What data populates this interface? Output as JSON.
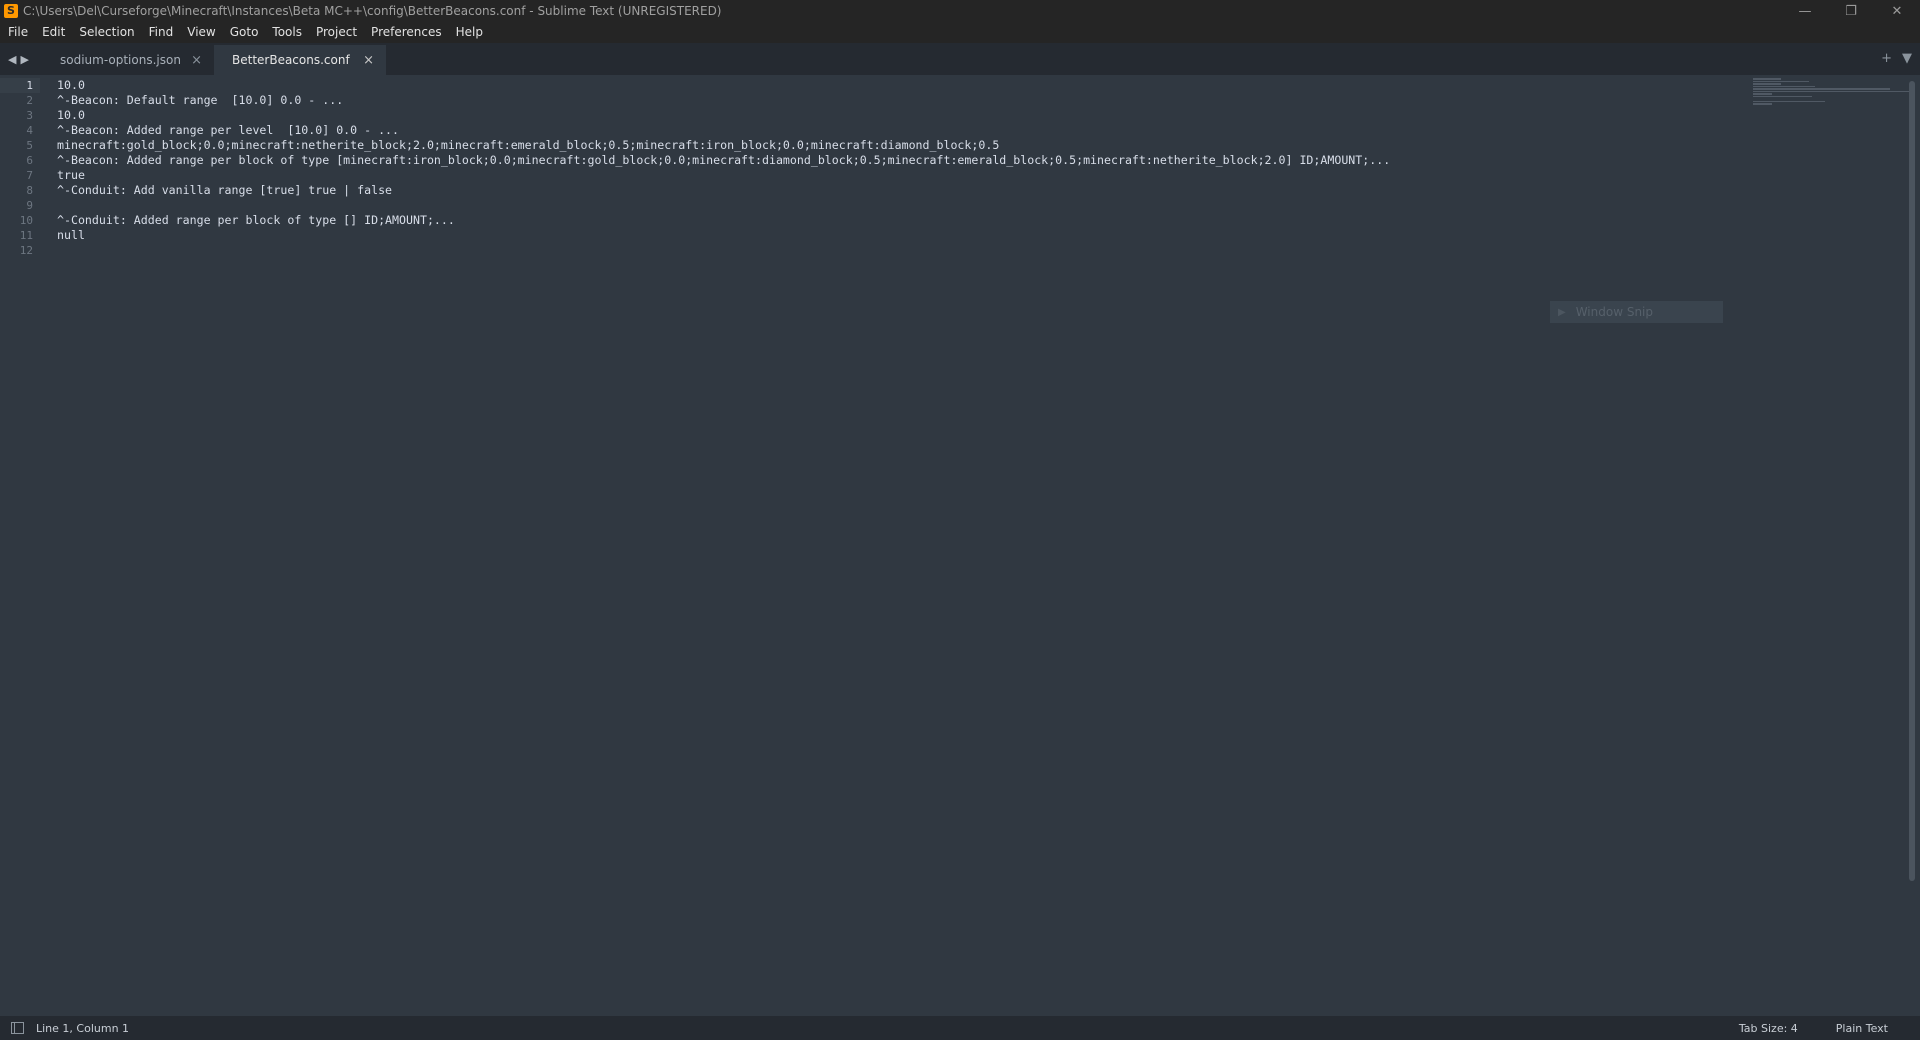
{
  "window": {
    "title": "C:\\Users\\Del\\Curseforge\\Minecraft\\Instances\\Beta MC++\\config\\BetterBeacons.conf - Sublime Text (UNREGISTERED)",
    "icon_letter": "S",
    "minimize_icon": "—",
    "restore_icon": "❐",
    "close_icon": "✕"
  },
  "menu": [
    "File",
    "Edit",
    "Selection",
    "Find",
    "View",
    "Goto",
    "Tools",
    "Project",
    "Preferences",
    "Help"
  ],
  "tabs": [
    {
      "label": "sodium-options.json",
      "active": false
    },
    {
      "label": "BetterBeacons.conf",
      "active": true
    }
  ],
  "tab_glyphs": {
    "prev": "◀",
    "next": "▶",
    "close": "×",
    "new": "+",
    "dropdown": "▼"
  },
  "editor": {
    "line_numbers": [
      "1",
      "2",
      "3",
      "4",
      "5",
      "6",
      "7",
      "8",
      "9",
      "10",
      "11",
      "12"
    ],
    "current_line": 1,
    "lines": [
      "10.0",
      "^-Beacon: Default range  [10.0] 0.0 - ...",
      "10.0",
      "^-Beacon: Added range per level  [10.0] 0.0 - ...",
      "minecraft:gold_block;0.0;minecraft:netherite_block;2.0;minecraft:emerald_block;0.5;minecraft:iron_block;0.0;minecraft:diamond_block;0.5",
      "^-Beacon: Added range per block of type [minecraft:iron_block;0.0;minecraft:gold_block;0.0;minecraft:diamond_block;0.5;minecraft:emerald_block;0.5;minecraft:netherite_block;2.0] ID;AMOUNT;...",
      "true",
      "^-Conduit: Add vanilla range [true] true | false",
      "",
      "^-Conduit: Added range per block of type [] ID;AMOUNT;...",
      "null",
      ""
    ]
  },
  "overlay": {
    "label": "Window Snip",
    "icon": "▶"
  },
  "status": {
    "position": "Line 1, Column 1",
    "tab_size": "Tab Size: 4",
    "syntax": "Plain Text"
  }
}
